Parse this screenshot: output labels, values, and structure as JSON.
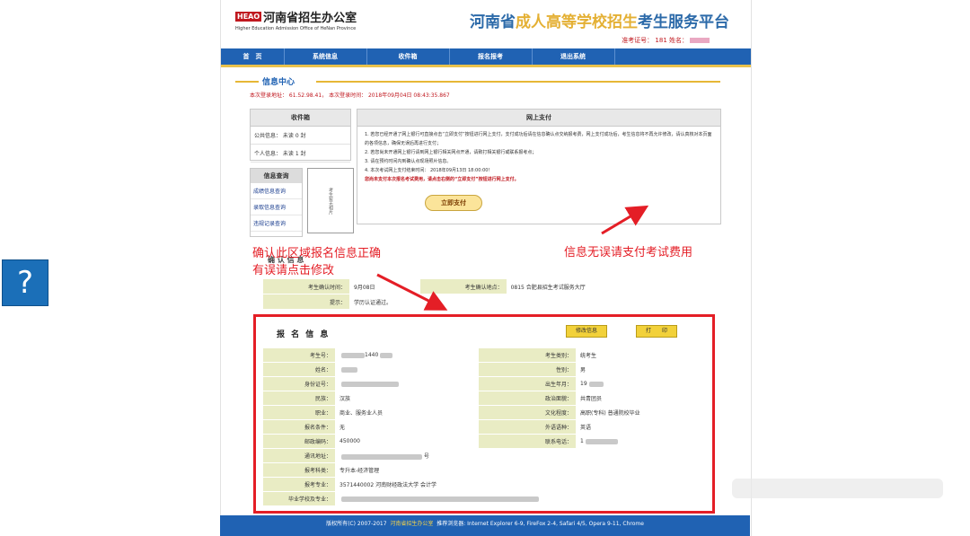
{
  "help": {
    "label": "?"
  },
  "header": {
    "logo_badge": "HEAO",
    "logo_cn": "河南省招生办公室",
    "logo_en": "Higher Education Admission Office of HeNan Province",
    "title_part1": "河南省",
    "title_part2": "成人高等学校招生",
    "title_part3": "考生服务平台",
    "login_user": "准考证号： 181      姓名："
  },
  "nav": {
    "items": [
      {
        "label": "首　页"
      },
      {
        "label": "系统信息"
      },
      {
        "label": "收件箱"
      },
      {
        "label": "报名报考"
      },
      {
        "label": "退出系统"
      }
    ]
  },
  "info_center": {
    "title": "信息中心",
    "login_info": "本次登录地址： 61.52.98.41， 本次登录时间： 2018年09月04日 08:43:35.867"
  },
  "inbox": {
    "title": "收件箱",
    "public": "公共信息：  未读  0  封",
    "personal": "个人信息：  未读  1  封"
  },
  "query": {
    "title": "信息查询",
    "links": [
      "成绩信息查询",
      "录取信息查询",
      "违规记录查询"
    ]
  },
  "photo": {
    "label": "考生暂无相片"
  },
  "payment": {
    "title": "网上支付",
    "items": [
      "1. 若您已经开通了网上银行可直接点击“立即支付”按钮进行网上支付，支付成功后请在信息确认点交纳报考费，网上支付成功后，考生信息将不再允许修改，请认真核对本页面的各项信息，确保无误后再进行支付；",
      "2. 若您尚未开通网上银行请到网上银行相关网点开通，请致打相关银行或联系报考点；",
      "3. 请在预约时间内到确认点现场照片信息。",
      "4. 本次考试网上支付结束时间： 2018年09月13日 18:00:00！"
    ],
    "warning": "您尚未支付本次报名考试费用，请点击右侧的“立即支付”按钮进行网上支付。",
    "pay_button": "立即支付"
  },
  "confirm": {
    "title": "确 认 信 息",
    "time_label": "考生确认时间：",
    "time_value": "9月08日",
    "place_label": "考生确认地点：",
    "place_value": "0815  合肥县招生考试服务大厅",
    "tip_label": "提示：",
    "tip_value": "学历认证通过。"
  },
  "registration": {
    "title": "报 名 信 息",
    "edit_button": "修改信息",
    "print_button": "打　　印",
    "rows": [
      {
        "l1": "考生号：",
        "v1": "1440",
        "l2": "考生类别：",
        "v2": "统考生"
      },
      {
        "l1": "姓名：",
        "v1": "",
        "l2": "性别：",
        "v2": "男"
      },
      {
        "l1": "身份证号：",
        "v1": "",
        "l2": "出生年月：",
        "v2": "19"
      },
      {
        "l1": "民族：",
        "v1": "汉族",
        "l2": "政治面貌：",
        "v2": "共青团员"
      },
      {
        "l1": "职业：",
        "v1": "商业、服务业人员",
        "l2": "文化程度：",
        "v2": "高职(专科) 普通院校毕业"
      },
      {
        "l1": "报名条件：",
        "v1": "无",
        "l2": "外语语种：",
        "v2": "英语"
      },
      {
        "l1": "邮政编码：",
        "v1": "450000",
        "l2": "联系电话：",
        "v2": "1"
      }
    ],
    "wide_rows": [
      {
        "label": "通讯地址：",
        "value": "号"
      },
      {
        "label": "报考科类：",
        "value": "专升本-经济管理"
      },
      {
        "label": "报考专业：",
        "value": "3571440002  河南财经政法大学  会计学"
      },
      {
        "label": "毕业学校及专业：",
        "value": ""
      }
    ]
  },
  "footer": {
    "copyright": "版权所有(C)  2007-2017",
    "org": "河南省招生办公室",
    "browsers": "推荐浏览器: Internet Explorer 6-9, FireFox 2-4, Safari 4/5, Opera 9-11, Chrome"
  },
  "annotations": {
    "left_line1": "确认此区域报名信息正确",
    "left_line2": "有误请点击修改",
    "right": "信息无误请支付考试费用"
  }
}
